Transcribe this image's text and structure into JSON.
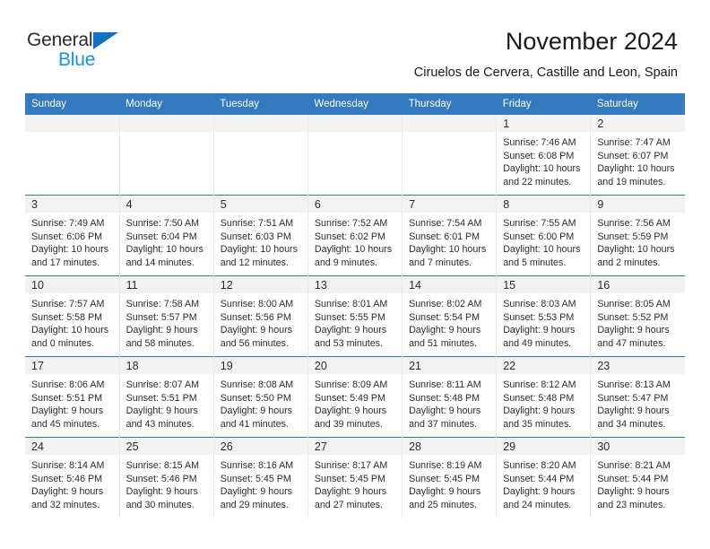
{
  "brand": {
    "name_top": "General",
    "name_bottom": "Blue",
    "accent_color": "#1271c4",
    "blue_text_color": "#1f8fe0"
  },
  "header": {
    "title": "November 2024",
    "subtitle": "Ciruelos de Cervera, Castille and Leon, Spain"
  },
  "colors": {
    "header_row_bg": "#3279bd",
    "daynum_band_bg": "#f2f2f2",
    "text": "#2b2b2b"
  },
  "weekdays": [
    "Sunday",
    "Monday",
    "Tuesday",
    "Wednesday",
    "Thursday",
    "Friday",
    "Saturday"
  ],
  "weeks": [
    [
      {
        "day": "",
        "sunrise": "",
        "sunset": "",
        "daylight_1": "",
        "daylight_2": ""
      },
      {
        "day": "",
        "sunrise": "",
        "sunset": "",
        "daylight_1": "",
        "daylight_2": ""
      },
      {
        "day": "",
        "sunrise": "",
        "sunset": "",
        "daylight_1": "",
        "daylight_2": ""
      },
      {
        "day": "",
        "sunrise": "",
        "sunset": "",
        "daylight_1": "",
        "daylight_2": ""
      },
      {
        "day": "",
        "sunrise": "",
        "sunset": "",
        "daylight_1": "",
        "daylight_2": ""
      },
      {
        "day": "1",
        "sunrise": "Sunrise: 7:46 AM",
        "sunset": "Sunset: 6:08 PM",
        "daylight_1": "Daylight: 10 hours",
        "daylight_2": "and 22 minutes."
      },
      {
        "day": "2",
        "sunrise": "Sunrise: 7:47 AM",
        "sunset": "Sunset: 6:07 PM",
        "daylight_1": "Daylight: 10 hours",
        "daylight_2": "and 19 minutes."
      }
    ],
    [
      {
        "day": "3",
        "sunrise": "Sunrise: 7:49 AM",
        "sunset": "Sunset: 6:06 PM",
        "daylight_1": "Daylight: 10 hours",
        "daylight_2": "and 17 minutes."
      },
      {
        "day": "4",
        "sunrise": "Sunrise: 7:50 AM",
        "sunset": "Sunset: 6:04 PM",
        "daylight_1": "Daylight: 10 hours",
        "daylight_2": "and 14 minutes."
      },
      {
        "day": "5",
        "sunrise": "Sunrise: 7:51 AM",
        "sunset": "Sunset: 6:03 PM",
        "daylight_1": "Daylight: 10 hours",
        "daylight_2": "and 12 minutes."
      },
      {
        "day": "6",
        "sunrise": "Sunrise: 7:52 AM",
        "sunset": "Sunset: 6:02 PM",
        "daylight_1": "Daylight: 10 hours",
        "daylight_2": "and 9 minutes."
      },
      {
        "day": "7",
        "sunrise": "Sunrise: 7:54 AM",
        "sunset": "Sunset: 6:01 PM",
        "daylight_1": "Daylight: 10 hours",
        "daylight_2": "and 7 minutes."
      },
      {
        "day": "8",
        "sunrise": "Sunrise: 7:55 AM",
        "sunset": "Sunset: 6:00 PM",
        "daylight_1": "Daylight: 10 hours",
        "daylight_2": "and 5 minutes."
      },
      {
        "day": "9",
        "sunrise": "Sunrise: 7:56 AM",
        "sunset": "Sunset: 5:59 PM",
        "daylight_1": "Daylight: 10 hours",
        "daylight_2": "and 2 minutes."
      }
    ],
    [
      {
        "day": "10",
        "sunrise": "Sunrise: 7:57 AM",
        "sunset": "Sunset: 5:58 PM",
        "daylight_1": "Daylight: 10 hours",
        "daylight_2": "and 0 minutes."
      },
      {
        "day": "11",
        "sunrise": "Sunrise: 7:58 AM",
        "sunset": "Sunset: 5:57 PM",
        "daylight_1": "Daylight: 9 hours",
        "daylight_2": "and 58 minutes."
      },
      {
        "day": "12",
        "sunrise": "Sunrise: 8:00 AM",
        "sunset": "Sunset: 5:56 PM",
        "daylight_1": "Daylight: 9 hours",
        "daylight_2": "and 56 minutes."
      },
      {
        "day": "13",
        "sunrise": "Sunrise: 8:01 AM",
        "sunset": "Sunset: 5:55 PM",
        "daylight_1": "Daylight: 9 hours",
        "daylight_2": "and 53 minutes."
      },
      {
        "day": "14",
        "sunrise": "Sunrise: 8:02 AM",
        "sunset": "Sunset: 5:54 PM",
        "daylight_1": "Daylight: 9 hours",
        "daylight_2": "and 51 minutes."
      },
      {
        "day": "15",
        "sunrise": "Sunrise: 8:03 AM",
        "sunset": "Sunset: 5:53 PM",
        "daylight_1": "Daylight: 9 hours",
        "daylight_2": "and 49 minutes."
      },
      {
        "day": "16",
        "sunrise": "Sunrise: 8:05 AM",
        "sunset": "Sunset: 5:52 PM",
        "daylight_1": "Daylight: 9 hours",
        "daylight_2": "and 47 minutes."
      }
    ],
    [
      {
        "day": "17",
        "sunrise": "Sunrise: 8:06 AM",
        "sunset": "Sunset: 5:51 PM",
        "daylight_1": "Daylight: 9 hours",
        "daylight_2": "and 45 minutes."
      },
      {
        "day": "18",
        "sunrise": "Sunrise: 8:07 AM",
        "sunset": "Sunset: 5:51 PM",
        "daylight_1": "Daylight: 9 hours",
        "daylight_2": "and 43 minutes."
      },
      {
        "day": "19",
        "sunrise": "Sunrise: 8:08 AM",
        "sunset": "Sunset: 5:50 PM",
        "daylight_1": "Daylight: 9 hours",
        "daylight_2": "and 41 minutes."
      },
      {
        "day": "20",
        "sunrise": "Sunrise: 8:09 AM",
        "sunset": "Sunset: 5:49 PM",
        "daylight_1": "Daylight: 9 hours",
        "daylight_2": "and 39 minutes."
      },
      {
        "day": "21",
        "sunrise": "Sunrise: 8:11 AM",
        "sunset": "Sunset: 5:48 PM",
        "daylight_1": "Daylight: 9 hours",
        "daylight_2": "and 37 minutes."
      },
      {
        "day": "22",
        "sunrise": "Sunrise: 8:12 AM",
        "sunset": "Sunset: 5:48 PM",
        "daylight_1": "Daylight: 9 hours",
        "daylight_2": "and 35 minutes."
      },
      {
        "day": "23",
        "sunrise": "Sunrise: 8:13 AM",
        "sunset": "Sunset: 5:47 PM",
        "daylight_1": "Daylight: 9 hours",
        "daylight_2": "and 34 minutes."
      }
    ],
    [
      {
        "day": "24",
        "sunrise": "Sunrise: 8:14 AM",
        "sunset": "Sunset: 5:46 PM",
        "daylight_1": "Daylight: 9 hours",
        "daylight_2": "and 32 minutes."
      },
      {
        "day": "25",
        "sunrise": "Sunrise: 8:15 AM",
        "sunset": "Sunset: 5:46 PM",
        "daylight_1": "Daylight: 9 hours",
        "daylight_2": "and 30 minutes."
      },
      {
        "day": "26",
        "sunrise": "Sunrise: 8:16 AM",
        "sunset": "Sunset: 5:45 PM",
        "daylight_1": "Daylight: 9 hours",
        "daylight_2": "and 29 minutes."
      },
      {
        "day": "27",
        "sunrise": "Sunrise: 8:17 AM",
        "sunset": "Sunset: 5:45 PM",
        "daylight_1": "Daylight: 9 hours",
        "daylight_2": "and 27 minutes."
      },
      {
        "day": "28",
        "sunrise": "Sunrise: 8:19 AM",
        "sunset": "Sunset: 5:45 PM",
        "daylight_1": "Daylight: 9 hours",
        "daylight_2": "and 25 minutes."
      },
      {
        "day": "29",
        "sunrise": "Sunrise: 8:20 AM",
        "sunset": "Sunset: 5:44 PM",
        "daylight_1": "Daylight: 9 hours",
        "daylight_2": "and 24 minutes."
      },
      {
        "day": "30",
        "sunrise": "Sunrise: 8:21 AM",
        "sunset": "Sunset: 5:44 PM",
        "daylight_1": "Daylight: 9 hours",
        "daylight_2": "and 23 minutes."
      }
    ]
  ]
}
